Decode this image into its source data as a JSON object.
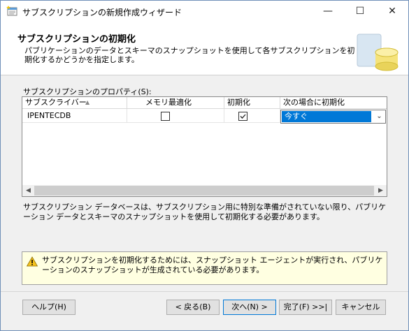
{
  "window": {
    "title": "サブスクリプションの新規作成ウィザード"
  },
  "header": {
    "title": "サブスクリプションの初期化",
    "description": "パブリケーションのデータとスキーマのスナップショットを使用して各サブスクリプションを初期化するかどうかを指定します。"
  },
  "properties": {
    "label": "サブスクリプションのプロパティ(S):",
    "columns": [
      "サブスクライバー",
      "メモリ最適化",
      "初期化",
      "次の場合に初期化"
    ],
    "rows": [
      {
        "subscriber": "IPENTECDB",
        "memory_optimized": false,
        "initialize": true,
        "initialize_when": "今すぐ"
      }
    ]
  },
  "info_text": "サブスクリプション データベースは、サブスクリプション用に特別な準備がされていない限り、パブリケーション データとスキーマのスナップショットを使用して初期化する必要があります。",
  "warning_text": "サブスクリプションを初期化するためには、スナップショット エージェントが実行され、パブリケーションのスナップショットが生成されている必要があります。",
  "buttons": {
    "help": "ヘルプ(H)",
    "back": "< 戻る(B)",
    "next": "次へ(N) >",
    "finish": "完了(F) >>|",
    "cancel": "キャンセル"
  }
}
